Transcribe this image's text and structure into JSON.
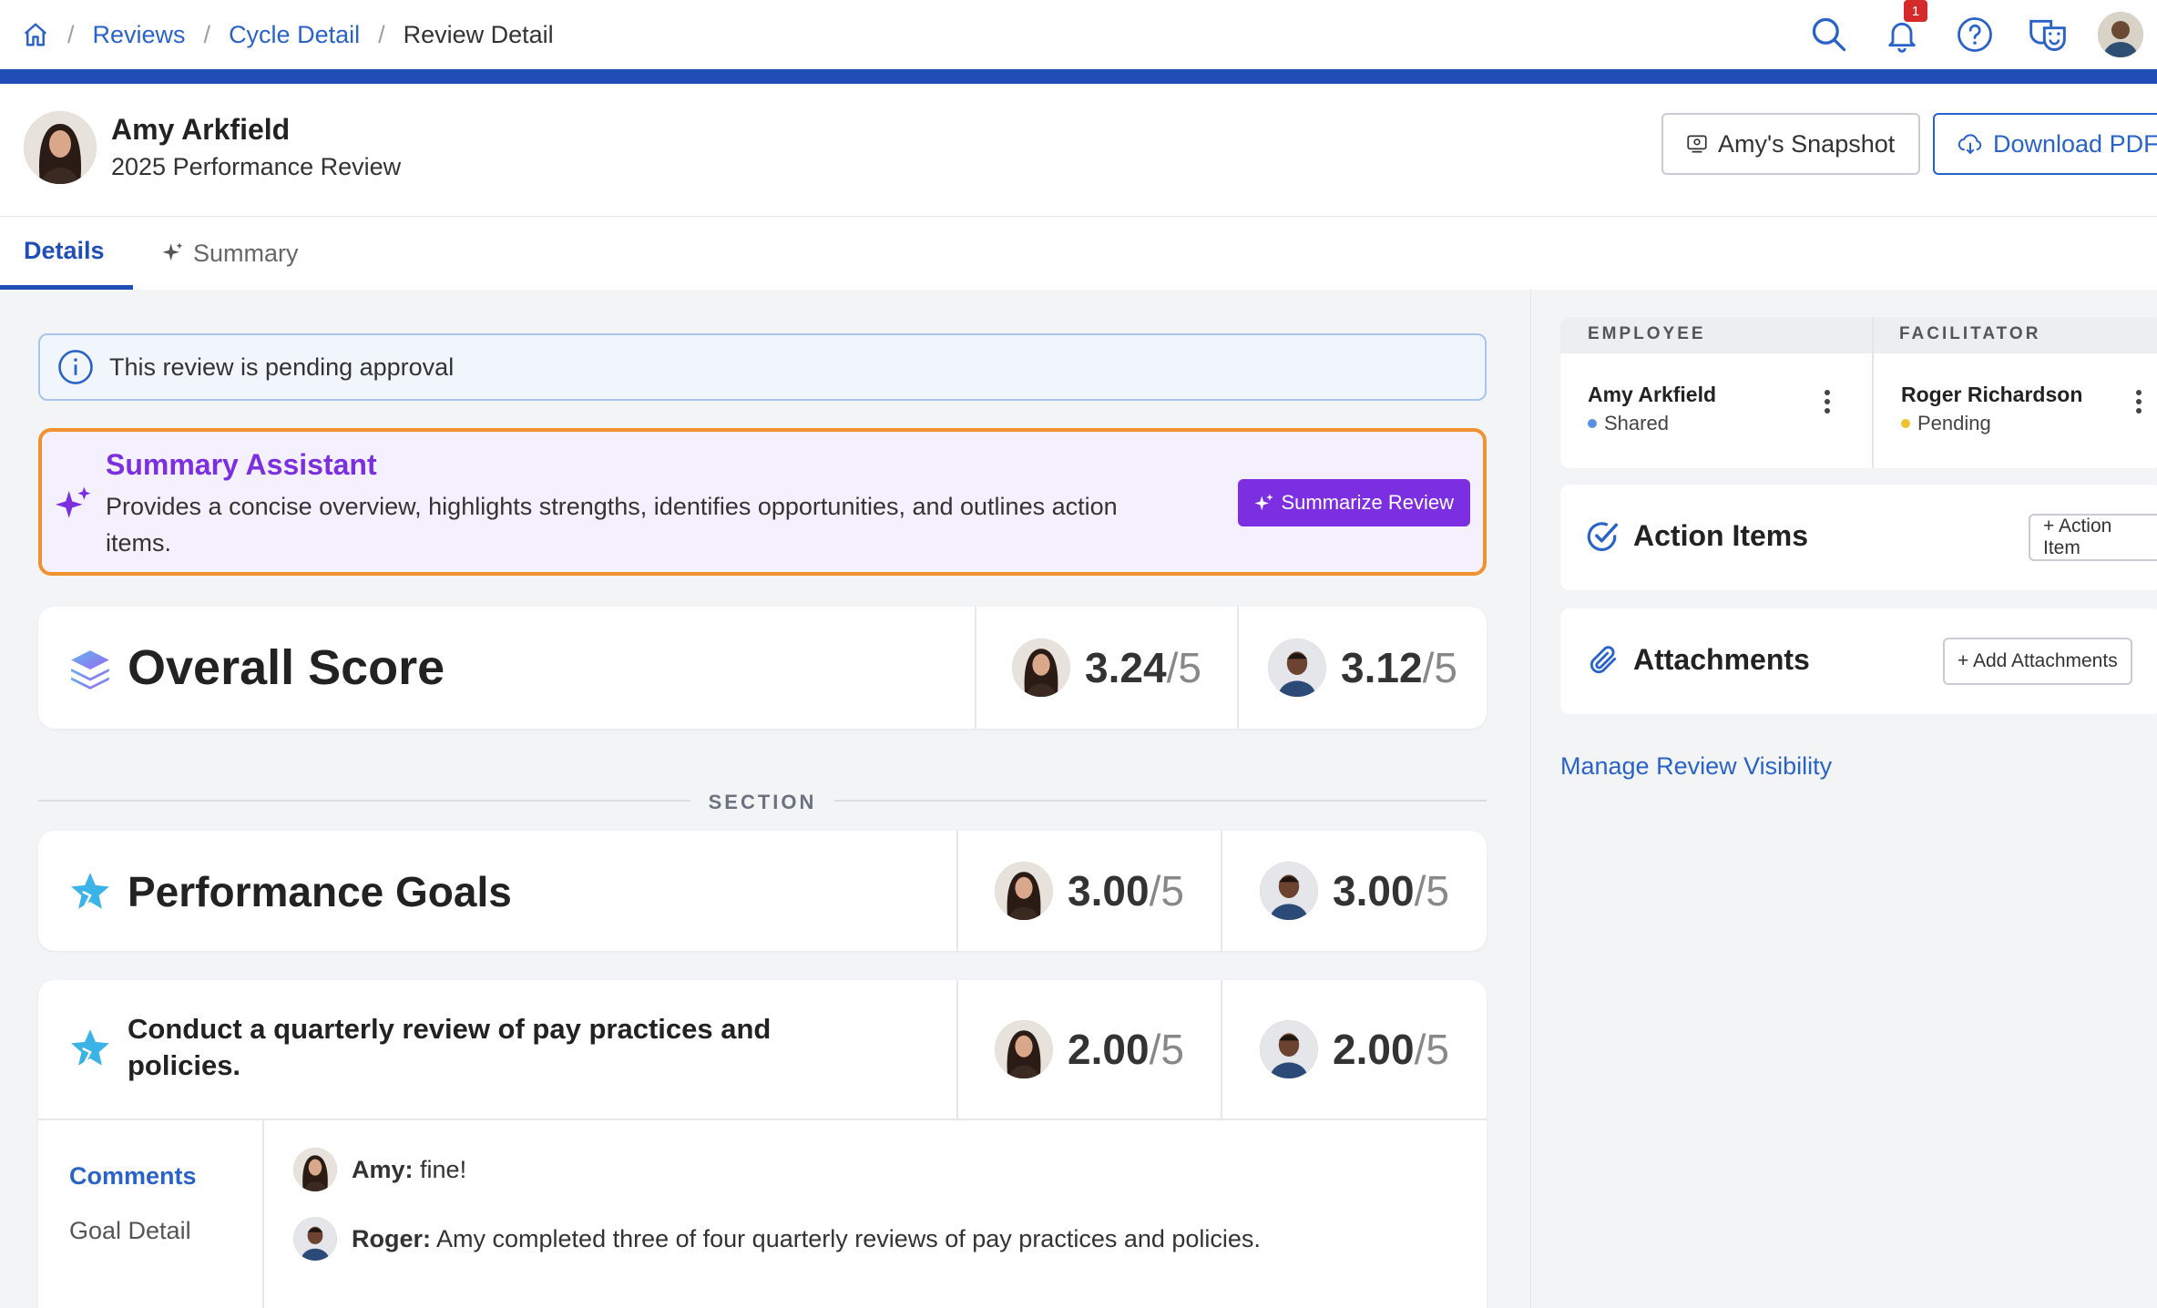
{
  "breadcrumb": {
    "items": [
      "Reviews",
      "Cycle Detail"
    ],
    "current": "Review Detail"
  },
  "topbar": {
    "notification_count": "1"
  },
  "header": {
    "name": "Amy Arkfield",
    "subtitle": "2025 Performance Review",
    "snapshot_button": "Amy's Snapshot",
    "download_button": "Download PDF"
  },
  "tabs": {
    "details": "Details",
    "summary": "Summary"
  },
  "banner": {
    "text": "This review is pending approval"
  },
  "assistant": {
    "title": "Summary Assistant",
    "description": "Provides a concise overview, highlights strengths, identifies opportunities, and outlines action items.",
    "button": "Summarize Review"
  },
  "overall": {
    "title": "Overall Score",
    "employee_score": "3.24",
    "facilitator_score": "3.12",
    "denominator": "/5"
  },
  "section": {
    "label": "SECTION"
  },
  "goals": {
    "title": "Performance Goals",
    "employee_score": "3.00",
    "facilitator_score": "3.00",
    "denominator": "/5"
  },
  "goal_item": {
    "title": "Conduct a quarterly review of pay practices and policies.",
    "employee_score": "2.00",
    "facilitator_score": "2.00",
    "denominator": "/5",
    "nav": {
      "comments": "Comments",
      "goal_detail": "Goal Detail"
    },
    "comments": [
      {
        "author": "Amy:",
        "text": "fine!"
      },
      {
        "author": "Roger:",
        "text": "Amy completed three of four quarterly reviews of pay practices and policies."
      }
    ]
  },
  "sidebar": {
    "employee_label": "EMPLOYEE",
    "facilitator_label": "FACILITATOR",
    "employee_name": "Amy Arkfield",
    "employee_status": "Shared",
    "facilitator_name": "Roger Richardson",
    "facilitator_status": "Pending",
    "action_items_title": "Action Items",
    "action_item_button": "+ Action Item",
    "attachments_title": "Attachments",
    "attachments_button": "+ Add Attachments",
    "manage_link": "Manage Review Visibility"
  },
  "colors": {
    "brand_blue": "#1f4fb4",
    "link_blue": "#2a63c8",
    "purple": "#7b2fe0",
    "orange_border": "#f0922f",
    "status_shared": "#5b8fe6",
    "status_pending": "#f2c12e"
  }
}
